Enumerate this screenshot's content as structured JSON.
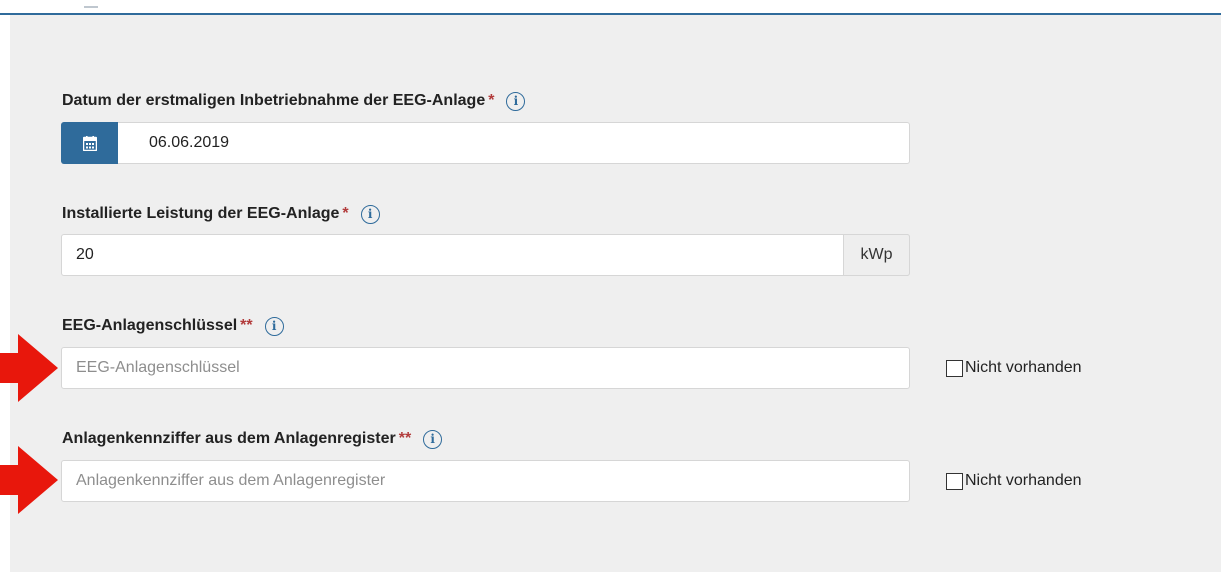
{
  "fields": [
    {
      "label": "Datum der erstmaligen Inbetriebnahme der EEG-Anlage",
      "required_marker": "*",
      "value": "06.06.2019",
      "icon": "calendar-icon"
    },
    {
      "label": "Installierte Leistung der EEG-Anlage",
      "required_marker": "*",
      "value": "20",
      "unit": "kWp"
    },
    {
      "label": "EEG-Anlagenschlüssel",
      "required_marker": "**",
      "placeholder": "EEG-Anlagenschlüssel",
      "checkbox_label": "Nicht vorhanden",
      "checked": false
    },
    {
      "label": "Anlagenkennziffer aus dem Anlagenregister",
      "required_marker": "**",
      "placeholder": "Anlagenkennziffer aus dem Anlagenregister",
      "checkbox_label": "Nicht vorhanden",
      "checked": false
    }
  ],
  "info_icon": "i",
  "colors": {
    "accent": "#2f6b9b",
    "required": "#b23b3b",
    "arrow": "#e8170c",
    "panel_bg": "#efefef"
  }
}
